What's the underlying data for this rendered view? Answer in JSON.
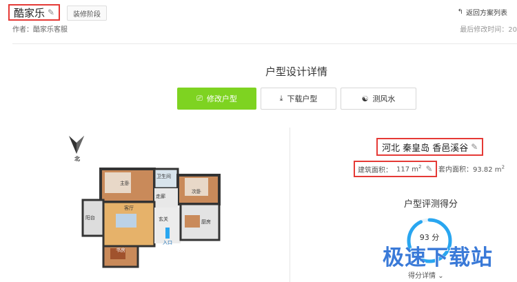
{
  "header": {
    "title": "酷家乐",
    "stage_button": "装修阶段",
    "author": "作者：酷家乐客服",
    "back_link": "返回方案列表",
    "last_modified": "最后修改时间：20"
  },
  "section": {
    "title": "户型设计详情",
    "buttons": {
      "edit": "修改户型",
      "download": "下载户型",
      "fengshui": "测风水"
    }
  },
  "floorplan": {
    "north": "北",
    "rooms": {
      "master": "主卧",
      "bath": "卫生间",
      "second": "次卧",
      "corridor": "走廊",
      "balcony": "阳台",
      "living": "客厅",
      "foyer": "玄关",
      "kitchen": "厨房",
      "study": "书房",
      "entrance": "入口"
    }
  },
  "info": {
    "address": "河北 秦皇岛 香邑溪谷",
    "build_area_label": "建筑面积：",
    "build_area_value": "117 m",
    "inner_area_label": "套内面积：",
    "inner_area_value": "93.82 m",
    "unit_sup": "2"
  },
  "score": {
    "title": "户型评测得分",
    "value": "93 分",
    "percent": 93,
    "detail": "得分详情",
    "ring_color": "#29a6f0"
  },
  "watermark": "极速下载站",
  "colors": {
    "accent": "#7ed321",
    "highlight": "#e53935"
  }
}
